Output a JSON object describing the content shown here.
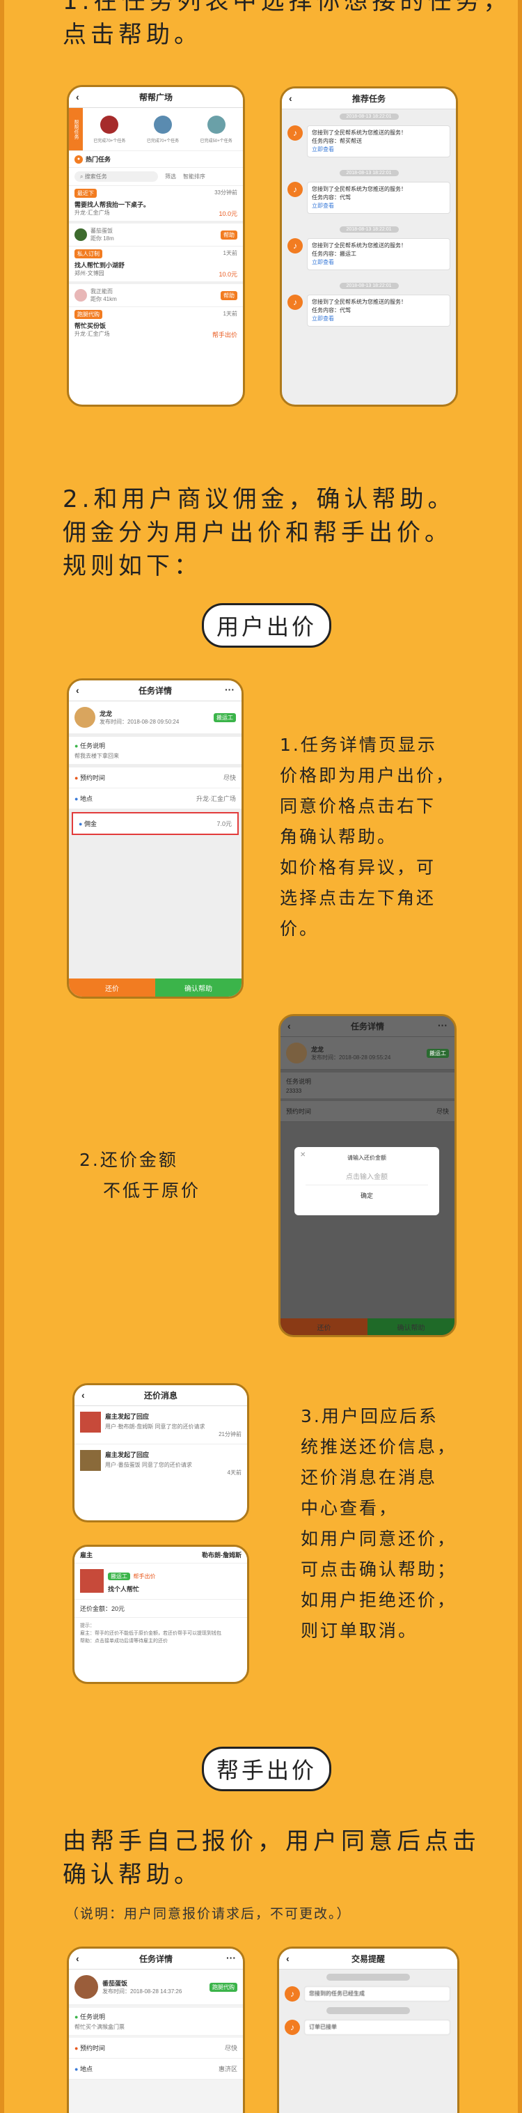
{
  "headings": {
    "s1": "1.在任务列表中选择你想接的任务，点击帮助。",
    "s2_l1": "2.和用户商议佣金，确认帮助。",
    "s2_l2": "佣金分为用户出价和帮手出价。",
    "s2_l3": "规则如下：",
    "pill_user": "用户出价",
    "pill_helper": "帮手出价",
    "helper_l1": "由帮手自己报价，用户同意后点击",
    "helper_l2": "确认帮助。",
    "helper_note": "（说明：用户同意报价请求后，不可更改。）"
  },
  "notes": {
    "n1": [
      "1.任务详情页显示",
      "价格即为用户出价，",
      "同意价格点击右下",
      "角确认帮助。",
      "如价格有异议，可",
      "选择点击左下角还",
      "价。"
    ],
    "n2": [
      "2.还价金额",
      "不低于原价"
    ],
    "n3": [
      "3.用户回应后系",
      "统推送还价信息，",
      "还价消息在消息",
      "中心查看，",
      "如用户同意还价，",
      "可点击确认帮助；",
      "如用户拒绝还价，",
      "则订单取消。"
    ]
  },
  "p1": {
    "title": "帮帮广场",
    "side_tag": "帮帮任务",
    "earn1": "已完成70+个任务",
    "earn2": "已完成70+个任务",
    "earn3": "已完成50+个任务",
    "hot": "热门任务",
    "search": "搜索任务",
    "filter1": "筛选",
    "filter2": "智能排序",
    "t1_label": "最近下",
    "t1_time": "33分钟前",
    "t1_title": "需要找人帮我抬一下桌子。",
    "t1_place": "升龙·汇金广场",
    "t1_price": "10.0元",
    "u1_name": "蕃茄蛋饭",
    "u1_dist": "距你 18m",
    "btn_help": "帮助",
    "t2_label": "私人订制",
    "t2_time": "1天前",
    "t2_title": "找人帮忙到小湖舒",
    "t2_place": "郑州·文博园",
    "t2_price": "10.0元",
    "u2_name": "我正能而",
    "u2_dist": "距你 41km",
    "t3_label": "跑腿代购",
    "t3_time": "1天前",
    "t3_title": "帮忙买份饭",
    "t3_place": "升龙·汇金广场",
    "t3_price": "帮手出价"
  },
  "p2": {
    "title": "推荐任务",
    "stamp": "2018-08-13 18:22:01",
    "msgs": [
      {
        "line1": "您接到了全民帮系统为您推送的服务！",
        "line2": "任务内容：帮买帮送",
        "link": "立即查看"
      },
      {
        "line1": "您接到了全民帮系统为您推送的服务！",
        "line2": "任务内容：代驾",
        "link": "立即查看"
      },
      {
        "line1": "您接到了全民帮系统为您推送的服务！",
        "line2": "任务内容：搬运工",
        "link": "立即查看"
      },
      {
        "line1": "您接到了全民帮系统为您推送的服务！",
        "line2": "任务内容：代驾",
        "link": "立即查看"
      }
    ]
  },
  "p3": {
    "title": "任务详情",
    "name": "龙龙",
    "time": "发布时间：2018-08-28 09:50:24",
    "badge": "搬运工",
    "desc_label": "任务说明",
    "desc": "帮我去楼下拿回来",
    "r1": "预约时间",
    "r1v": "尽快",
    "r2": "地点",
    "r2v": "升龙·汇金广场",
    "r3": "佣金",
    "r3v": "7.0元",
    "btn_left": "还价",
    "btn_right": "确认帮助"
  },
  "p4": {
    "title": "任务详情",
    "name": "龙龙",
    "time": "发布时间：2018-08-28 09:55:24",
    "badge": "搬运工",
    "desc_label": "任务说明",
    "desc": "23333",
    "r1": "预约时间",
    "r1v": "尽快",
    "dlg_title": "请输入还价金额",
    "dlg_input": "点击输入金额",
    "dlg_btn": "确定",
    "btn_left": "还价",
    "btn_right": "确认帮助"
  },
  "p5": {
    "title": "还价消息",
    "m1_t": "雇主发起了回应",
    "m1_s": "用户·勒布朗-詹姆斯 同意了您的还价请求",
    "m1_time": "21分钟前",
    "m2_t": "雇主发起了回应",
    "m2_s": "用户·番茄蛋饭 同意了您的还价请求",
    "m2_time": "4天前"
  },
  "p6": {
    "left": "雇主",
    "right": "勒布朗-詹姆斯",
    "tag": "搬运工",
    "sub": "帮手出价",
    "task": "找个人帮忙",
    "amount": "还价金额：20元",
    "tip": "提示：\n雇主：帮手的还价不能低于原价金额，若还价帮手可以提现到钱包\n帮助：点击接单成功后请等待雇主的还价"
  },
  "p7": {
    "title": "任务详情",
    "name": "番茄蛋饭",
    "time": "发布时间：2018-08-28 14:37:26",
    "badge": "跑腿代购",
    "desc_label": "任务说明",
    "desc": "帮忙买个满猴盒门票",
    "r1": "预约时间",
    "r1v": "尽快",
    "r2": "地点",
    "r2v": "惠济区"
  },
  "p8": {
    "title": "交易提醒",
    "m1": "您接到的任务已经生成",
    "m2": "订单已接单"
  }
}
